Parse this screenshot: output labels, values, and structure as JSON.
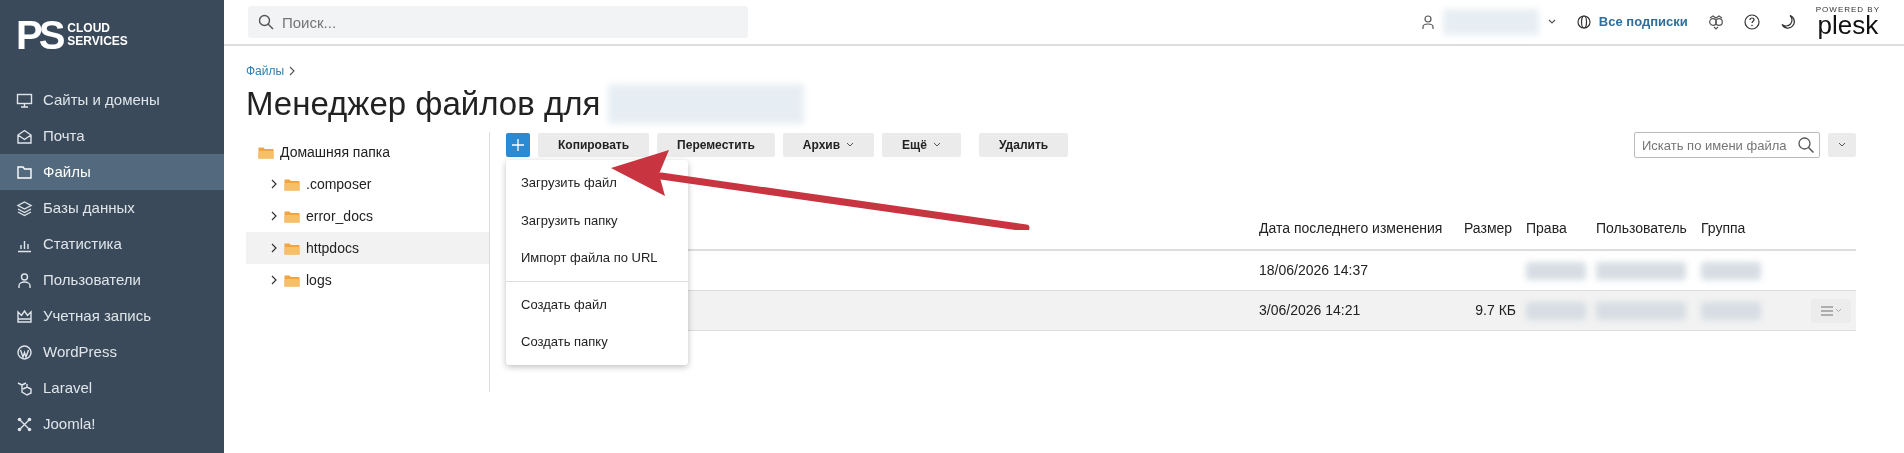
{
  "logo": {
    "mark": "PS",
    "line1": "CLOUD",
    "line2": "SERVICES"
  },
  "sidebar": {
    "items": [
      {
        "label": "Сайты и домены",
        "selected": false
      },
      {
        "label": "Почта",
        "selected": false
      },
      {
        "label": "Файлы",
        "selected": true
      },
      {
        "label": "Базы данных",
        "selected": false
      },
      {
        "label": "Статистика",
        "selected": false
      },
      {
        "label": "Пользователи",
        "selected": false
      },
      {
        "label": "Учетная запись",
        "selected": false
      },
      {
        "label": "WordPress",
        "selected": false
      },
      {
        "label": "Laravel",
        "selected": false
      },
      {
        "label": "Joomla!",
        "selected": false
      }
    ]
  },
  "topbar": {
    "search": {
      "placeholder": "Поиск..."
    },
    "subscriptions": "Все подписки",
    "powered_by": "POWERED BY",
    "brand": "plesk"
  },
  "breadcrumb": [
    "Файлы"
  ],
  "title": "Менеджер файлов для",
  "tree": {
    "label": "Домашняя папка",
    "children": [
      {
        "label": ".composer",
        "expanded": false,
        "selected": false
      },
      {
        "label": "error_docs",
        "expanded": false,
        "selected": false
      },
      {
        "label": "httpdocs",
        "expanded": false,
        "selected": true
      },
      {
        "label": "logs",
        "expanded": false,
        "selected": false
      }
    ]
  },
  "toolbar": {
    "buttons": [
      {
        "label": "Копировать",
        "dropdown": false
      },
      {
        "label": "Переместить",
        "dropdown": false
      },
      {
        "label": "Архив",
        "dropdown": true
      },
      {
        "label": "Ещё",
        "dropdown": true
      },
      {
        "label": "Удалить",
        "dropdown": false
      }
    ],
    "file_search": {
      "placeholder": "Искать по имени файла"
    }
  },
  "add_menu": {
    "groups": [
      [
        "Загрузить файл",
        "Загрузить папку",
        "Импорт файла по URL"
      ],
      [
        "Создать файл",
        "Создать папку"
      ]
    ]
  },
  "table": {
    "columns": [
      "Дата последнего изменения",
      "Размер",
      "Права",
      "Пользователь",
      "Группа"
    ],
    "rows": [
      {
        "modified": "18/06/2026 14:37",
        "highlighted": false,
        "actions": false
      },
      {
        "modified": "3/06/2026 14:21",
        "size": "9.7 КБ",
        "highlighted": true,
        "actions": true
      }
    ]
  }
}
